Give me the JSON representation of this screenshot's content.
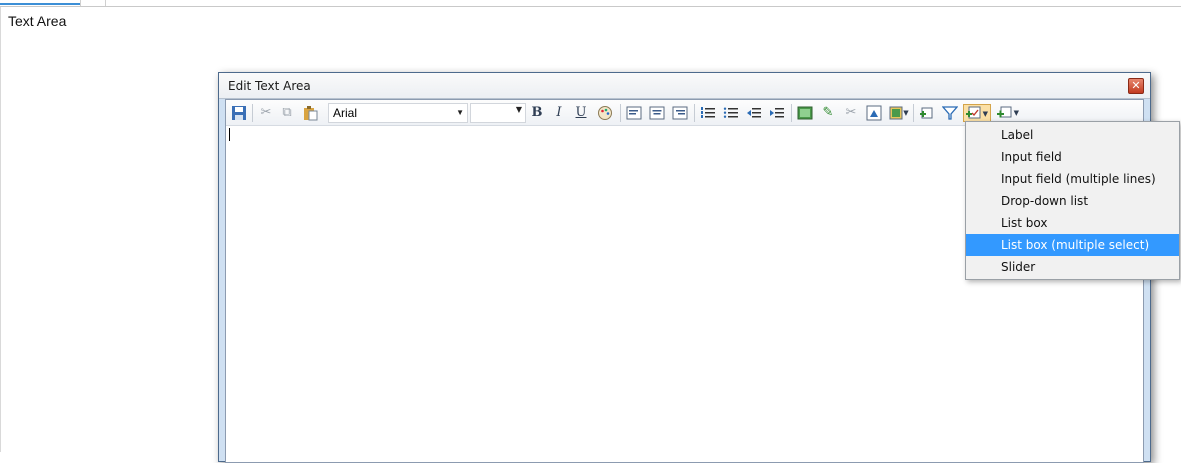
{
  "page": {
    "title": "Text Area"
  },
  "dialog": {
    "title": "Edit Text Area",
    "close_glyph": "✕"
  },
  "toolbar": {
    "font_name": "Arial",
    "font_size": "",
    "bold_label": "B",
    "italic_label": "I",
    "underline_label": "U",
    "icons": [
      "save-icon",
      "cut-icon",
      "copy-icon",
      "paste-icon",
      "bold-icon",
      "italic-icon",
      "underline-icon",
      "color-palette-icon",
      "align-left-icon",
      "align-center-icon",
      "align-right-icon",
      "numbered-list-icon",
      "bulleted-list-icon",
      "outdent-icon",
      "indent-icon",
      "image-icon",
      "link-icon",
      "unlink-icon",
      "anchor-icon",
      "table-icon",
      "insert-field-icon",
      "filter-icon",
      "form-controls-icon",
      "add-control-icon"
    ]
  },
  "menu": {
    "items": [
      {
        "label": "Label",
        "selected": false
      },
      {
        "label": "Input field",
        "selected": false
      },
      {
        "label": "Input field (multiple lines)",
        "selected": false
      },
      {
        "label": "Drop-down list",
        "selected": false
      },
      {
        "label": "List box",
        "selected": false
      },
      {
        "label": "List box (multiple select)",
        "selected": true
      },
      {
        "label": "Slider",
        "selected": false
      }
    ]
  },
  "colors": {
    "accent": "#3399ff",
    "dialog_frame": "#cfe0f2",
    "close_button": "#c23a1f"
  }
}
